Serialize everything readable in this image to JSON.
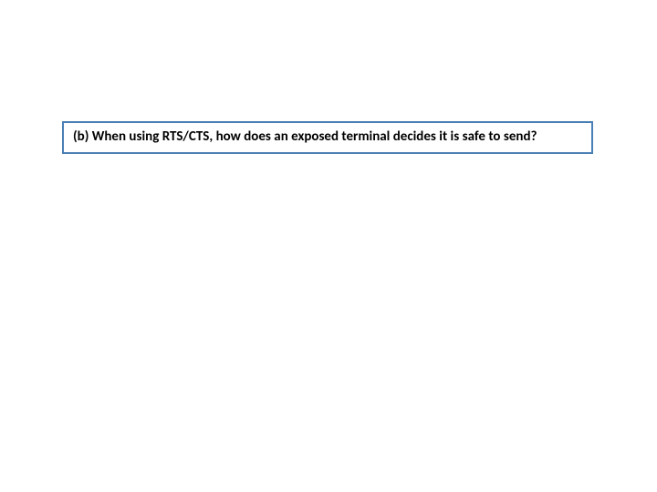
{
  "question": {
    "text": "(b) When using RTS/CTS, how does an exposed terminal decides it is safe to send?"
  }
}
